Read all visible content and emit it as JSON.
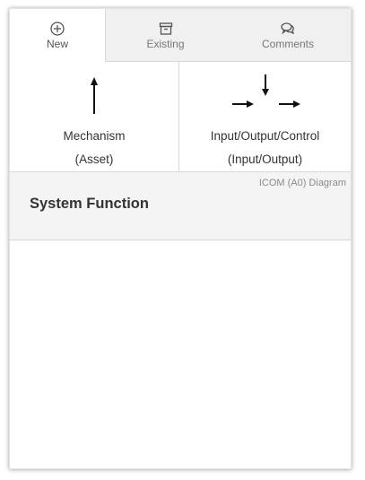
{
  "tabs": [
    {
      "label": "New",
      "icon": "plus-circle-icon"
    },
    {
      "label": "Existing",
      "icon": "archive-box-icon"
    },
    {
      "label": "Comments",
      "icon": "chat-bubbles-icon"
    }
  ],
  "types": {
    "mechanism": {
      "line1": "Mechanism",
      "line2": "(Asset)",
      "icon": "arrow-up-icon"
    },
    "icoc": {
      "line1": "Input/Output/Control",
      "line2": "(Input/Output)",
      "icon": "io-arrows-icon"
    }
  },
  "function": {
    "diagram_label": "ICOM (A0) Diagram",
    "title": "System Function"
  }
}
